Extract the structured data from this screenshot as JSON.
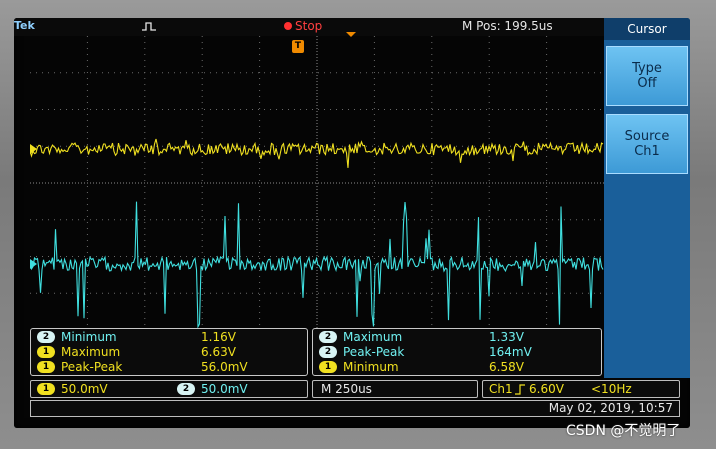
{
  "topbar": {
    "brand": "Tek",
    "trigger_icon": "pulse-icon",
    "acq_state": "Stop",
    "mpos": "M Pos: 199.5us",
    "trigger_marker_label": "T"
  },
  "side_menu": {
    "title": "Cursor",
    "type_label": "Type",
    "type_value": "Off",
    "source_label": "Source",
    "source_value": "Ch1"
  },
  "measurements_left": [
    {
      "channel": "2",
      "label": "Minimum",
      "value": "1.16V"
    },
    {
      "channel": "1",
      "label": "Maximum",
      "value": "6.63V"
    },
    {
      "channel": "1",
      "label": "Peak-Peak",
      "value": "56.0mV"
    }
  ],
  "measurements_right": [
    {
      "channel": "2",
      "label": "Maximum",
      "value": "1.33V"
    },
    {
      "channel": "2",
      "label": "Peak-Peak",
      "value": "164mV"
    },
    {
      "channel": "1",
      "label": "Minimum",
      "value": "6.58V"
    }
  ],
  "channel_scales": {
    "ch1_badge": "1",
    "ch1_scale": "50.0mV",
    "ch2_badge": "2",
    "ch2_scale": "50.0mV"
  },
  "timebase": "M 250us",
  "trigger": {
    "source": "Ch1",
    "slope_icon": "rising-edge-icon",
    "level": "6.60V",
    "freq": "<10Hz"
  },
  "datetime": "May 02, 2019, 10:57",
  "watermark": "CSDN @不觉明了",
  "colors": {
    "ch1": "#f0e020",
    "ch2": "#40e0e0",
    "accent": "#1a5f9a",
    "stop": "#ff3030"
  }
}
